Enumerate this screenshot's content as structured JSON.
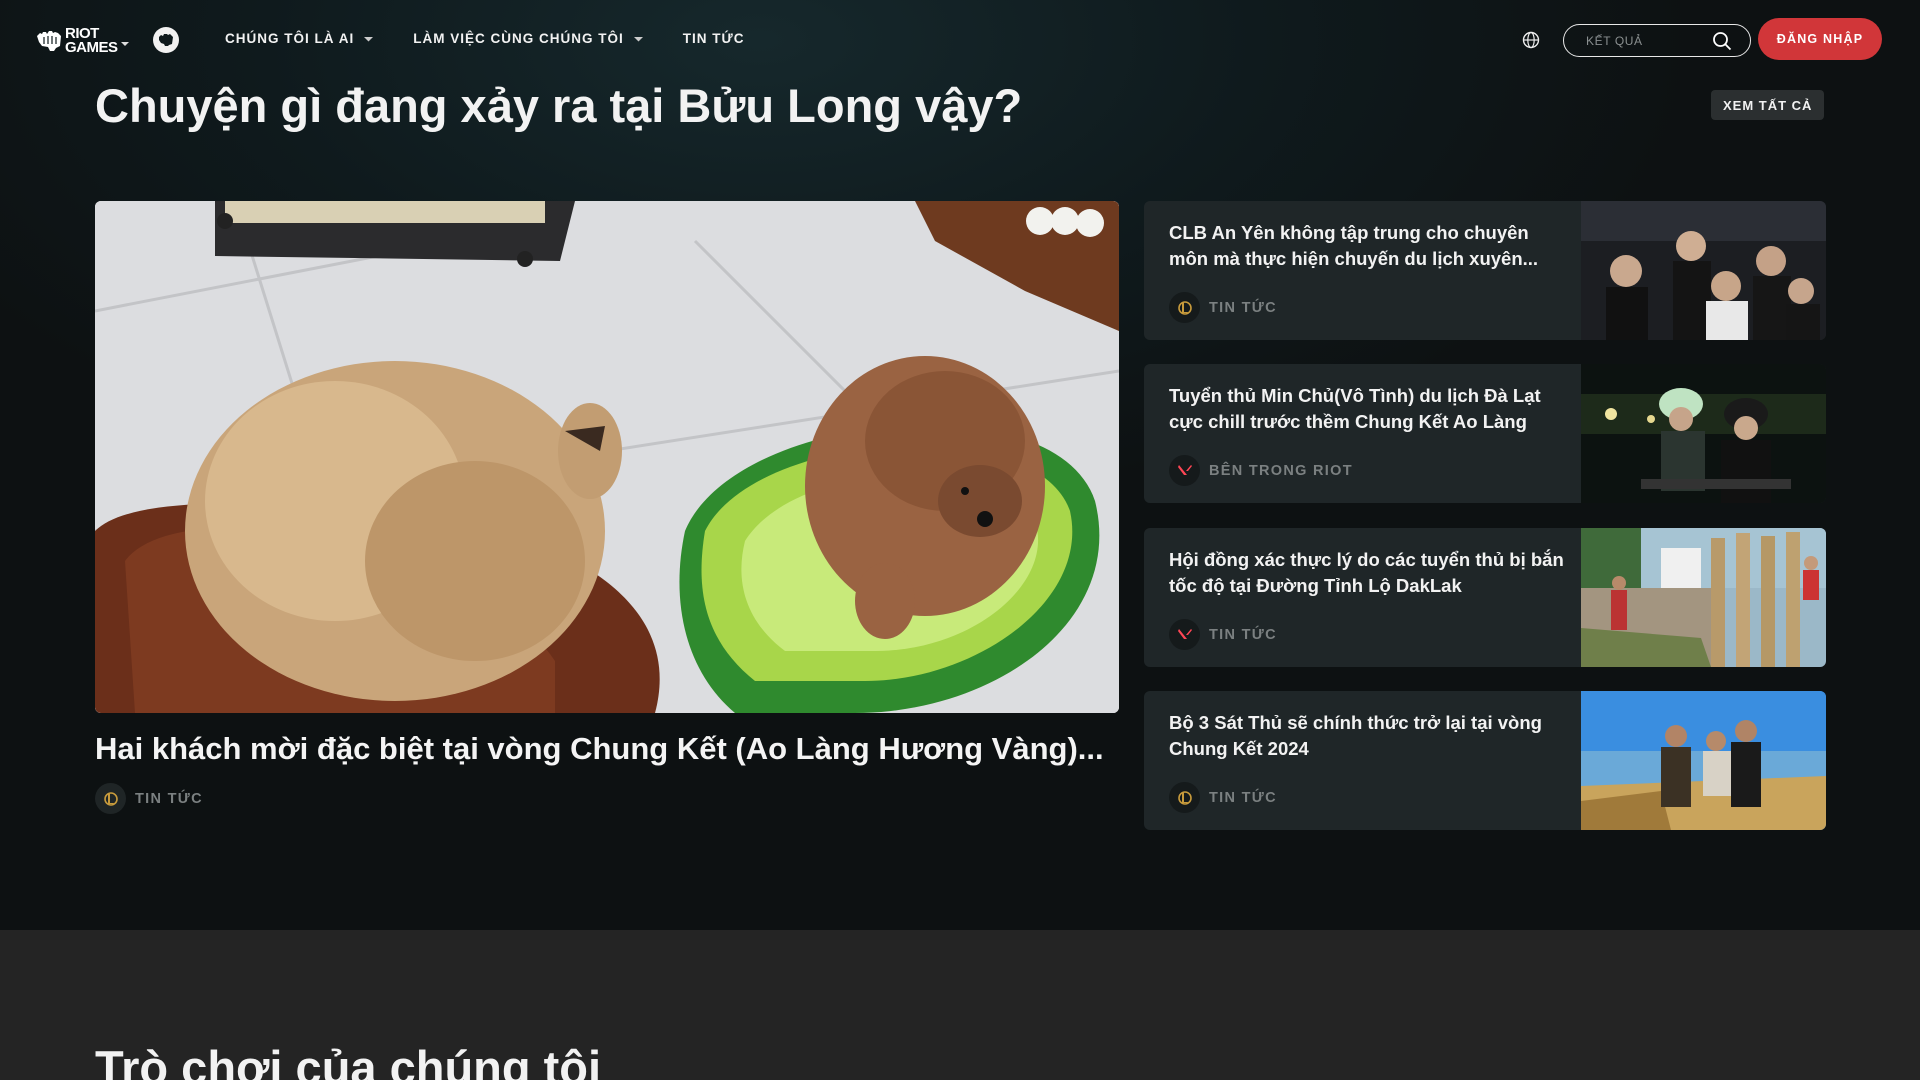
{
  "brand": {
    "wordmark_line1": "RIOT",
    "wordmark_line2": "GAMES"
  },
  "nav": {
    "links": [
      {
        "label": "CHÚNG TÔI LÀ AI",
        "dropdown": true
      },
      {
        "label": "LÀM VIỆC CÙNG CHÚNG TÔI",
        "dropdown": true
      },
      {
        "label": "TIN TỨC",
        "dropdown": false
      }
    ],
    "search_placeholder": "KẾT QUẢ",
    "login_label": "ĐĂNG NHẬP"
  },
  "news": {
    "heading": "Chuyện gì đang xảy ra tại Bửu Long vậy?",
    "see_all_label": "XEM TẤT CẢ",
    "featured": {
      "title": "Hai khách mời đặc biệt tại vòng Chung Kết (Ao Làng Hương Vàng)...",
      "category": "TIN TỨC",
      "category_icon": "lol-icon"
    },
    "cards": [
      {
        "title": "CLB An Yên không tập trung cho chuyên môn mà thực hiện chuyến du lịch xuyên...",
        "category": "TIN TỨC",
        "category_icon": "lol-icon"
      },
      {
        "title": "Tuyển thủ Min Chủ(Vô Tình) du lịch Đà Lạt cực chill trước thềm Chung Kết Ao Làng",
        "category": "BÊN TRONG RIOT",
        "category_icon": "valorant-icon"
      },
      {
        "title": "Hội đồng xác thực lý do các tuyển thủ bị bắn tốc độ tại Đường Tỉnh Lộ DakLak",
        "category": "TIN TỨC",
        "category_icon": "valorant-icon"
      },
      {
        "title": "Bộ 3 Sát Thủ sẽ chính thức trở lại tại vòng Chung Kết 2024",
        "category": "TIN TỨC",
        "category_icon": "lol-icon"
      }
    ]
  },
  "games_section": {
    "heading": "Trò chơi của chúng tôi"
  },
  "colors": {
    "accent": "#d13639",
    "background": "#111314",
    "card": "#1f2628",
    "muted_text": "#7b8081",
    "lol_gold": "#c89b3c",
    "valorant_red": "#ff4655"
  }
}
